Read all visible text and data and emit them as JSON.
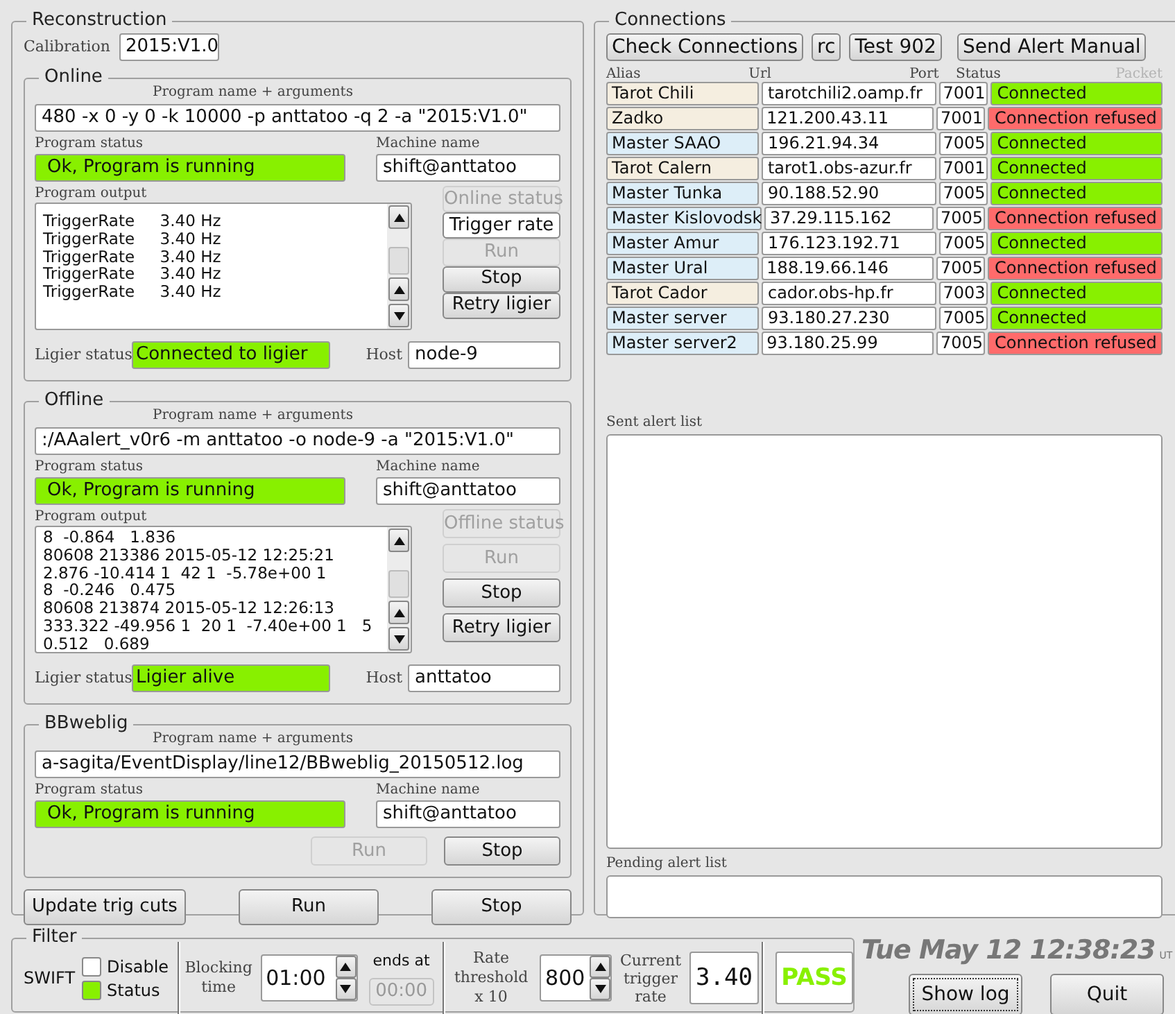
{
  "reconstruction": {
    "title": "Reconstruction",
    "calibration_label": "Calibration",
    "calibration": "2015:V1.0",
    "sections": [
      {
        "title": "Online",
        "args_label": "Program name + arguments",
        "args": "480 -x 0 -y 0 -k 10000 -p anttatoo -q 2 -a \"2015:V1.0\"",
        "status_label": "Program status",
        "status": "Ok, Program is running",
        "machine_label": "Machine name",
        "machine": "shift@anttatoo",
        "output_label": "Program output",
        "output": [
          "TriggerRate     3.40 Hz",
          "TriggerRate     3.40 Hz",
          "TriggerRate     3.40 Hz",
          "TriggerRate     3.40 Hz",
          "TriggerRate     3.40 Hz"
        ],
        "buttons": [
          {
            "label": "Online status",
            "disabled": true
          },
          {
            "label": "Trigger rate",
            "disabled": false,
            "kind": "flat"
          },
          {
            "label": "Run",
            "disabled": true
          },
          {
            "label": "Stop",
            "disabled": false
          },
          {
            "label": "Retry ligier",
            "disabled": false
          }
        ],
        "ligier_label": "Ligier status",
        "ligier": "Connected to ligier",
        "host_label": "Host",
        "host": "node-9"
      },
      {
        "title": "Offline",
        "args_label": "Program name + arguments",
        "args": ":/AAalert_v0r6 -m anttatoo -o node-9   -a \"2015:V1.0\"",
        "status_label": "Program status",
        "status": "Ok, Program is running",
        "machine_label": "Machine name",
        "machine": "shift@anttatoo",
        "output_label": "Program output",
        "output": [
          "8  -0.864   1.836",
          "80608 213386 2015-05-12 12:25:21",
          "2.876 -10.414 1  42 1  -5.78e+00 1",
          "8  -0.246   0.475",
          "80608 213874 2015-05-12 12:26:13",
          "333.322 -49.956 1  20 1  -7.40e+00 1   5",
          "0.512   0.689"
        ],
        "buttons": [
          {
            "label": "Offline status",
            "disabled": true
          },
          {
            "label": "Run",
            "disabled": true
          },
          {
            "label": "Stop",
            "disabled": false
          },
          {
            "label": "Retry ligier",
            "disabled": false
          }
        ],
        "ligier_label": "Ligier status",
        "ligier": "Ligier alive",
        "host_label": "Host",
        "host": "anttatoo"
      },
      {
        "title": "BBweblig",
        "args_label": "Program name + arguments",
        "args": "a-sagita/EventDisplay/line12/BBweblig_20150512.log",
        "status_label": "Program status",
        "status": "Ok, Program is running",
        "machine_label": "Machine name",
        "machine": "shift@anttatoo",
        "buttons": [
          {
            "label": "Run",
            "disabled": true
          },
          {
            "label": "Stop",
            "disabled": false
          }
        ]
      }
    ],
    "buttons": [
      {
        "label": "Update trig cuts",
        "disabled": false
      },
      {
        "label": "Run",
        "disabled": false
      },
      {
        "label": "Stop",
        "disabled": false
      }
    ]
  },
  "connections": {
    "title": "Connections",
    "buttons": [
      "Check Connections",
      "rc",
      "Test 902",
      "Send Alert Manual"
    ],
    "columns": [
      {
        "label": "Alias",
        "disabled": false
      },
      {
        "label": "Url",
        "disabled": false
      },
      {
        "label": "Port",
        "disabled": false
      },
      {
        "label": "Status",
        "disabled": false
      },
      {
        "label": "Packet",
        "disabled": true
      }
    ],
    "rows": [
      {
        "alias": "Tarot Chili",
        "color": "#f5eee0",
        "url": "tarotchili2.oamp.fr",
        "port": "7001",
        "status": "Connected",
        "ok": true
      },
      {
        "alias": "Zadko",
        "color": "#f5eee0",
        "url": "121.200.43.11",
        "port": "7001",
        "status": "Connection refused",
        "ok": false
      },
      {
        "alias": "Master SAAO",
        "color": "#ddeef8",
        "url": "196.21.94.34",
        "port": "7005",
        "status": "Connected",
        "ok": true
      },
      {
        "alias": "Tarot Calern",
        "color": "#f5eee0",
        "url": "tarot1.obs-azur.fr",
        "port": "7001",
        "status": "Connected",
        "ok": true
      },
      {
        "alias": "Master Tunka",
        "color": "#ddeef8",
        "url": "90.188.52.90",
        "port": "7005",
        "status": "Connected",
        "ok": true
      },
      {
        "alias": "Master Kislovodsk",
        "color": "#ddeef8",
        "url": "37.29.115.162",
        "port": "7005",
        "status": "Connection refused",
        "ok": false
      },
      {
        "alias": "Master Amur",
        "color": "#ddeef8",
        "url": "176.123.192.71",
        "port": "7005",
        "status": "Connected",
        "ok": true
      },
      {
        "alias": "Master Ural",
        "color": "#ddeef8",
        "url": "188.19.66.146",
        "port": "7005",
        "status": "Connection refused",
        "ok": false
      },
      {
        "alias": "Tarot Cador",
        "color": "#f5eee0",
        "url": "cador.obs-hp.fr",
        "port": "7003",
        "status": "Connected",
        "ok": true
      },
      {
        "alias": "Master server",
        "color": "#ddeef8",
        "url": "93.180.27.230",
        "port": "7005",
        "status": "Connected",
        "ok": true
      },
      {
        "alias": "Master server2",
        "color": "#ddeef8",
        "url": "93.180.25.99",
        "port": "7005",
        "status": "Connection refused",
        "ok": false
      }
    ],
    "sent_label": "Sent alert list",
    "pending_label": "Pending alert list"
  },
  "filter": {
    "title": "Filter",
    "swift_label": "SWIFT",
    "checkboxes": [
      {
        "label": "Disable",
        "checked": false
      },
      {
        "label": "Status",
        "checked": true
      }
    ],
    "blocking_label": "Blocking time",
    "blocking": "01:00",
    "ends_label": "ends at",
    "ends": "00:00",
    "threshold_label": "Rate threshold x 10",
    "threshold": "800",
    "rate_label": "Current trigger rate",
    "rate": "3.40",
    "result": "PASS",
    "pass": true
  },
  "clock": "Tue May 12 12:38:23",
  "clock_unit": "UT",
  "buttons": [
    {
      "label": "Show log",
      "focused": true
    },
    {
      "label": "Quit",
      "focused": false
    }
  ]
}
